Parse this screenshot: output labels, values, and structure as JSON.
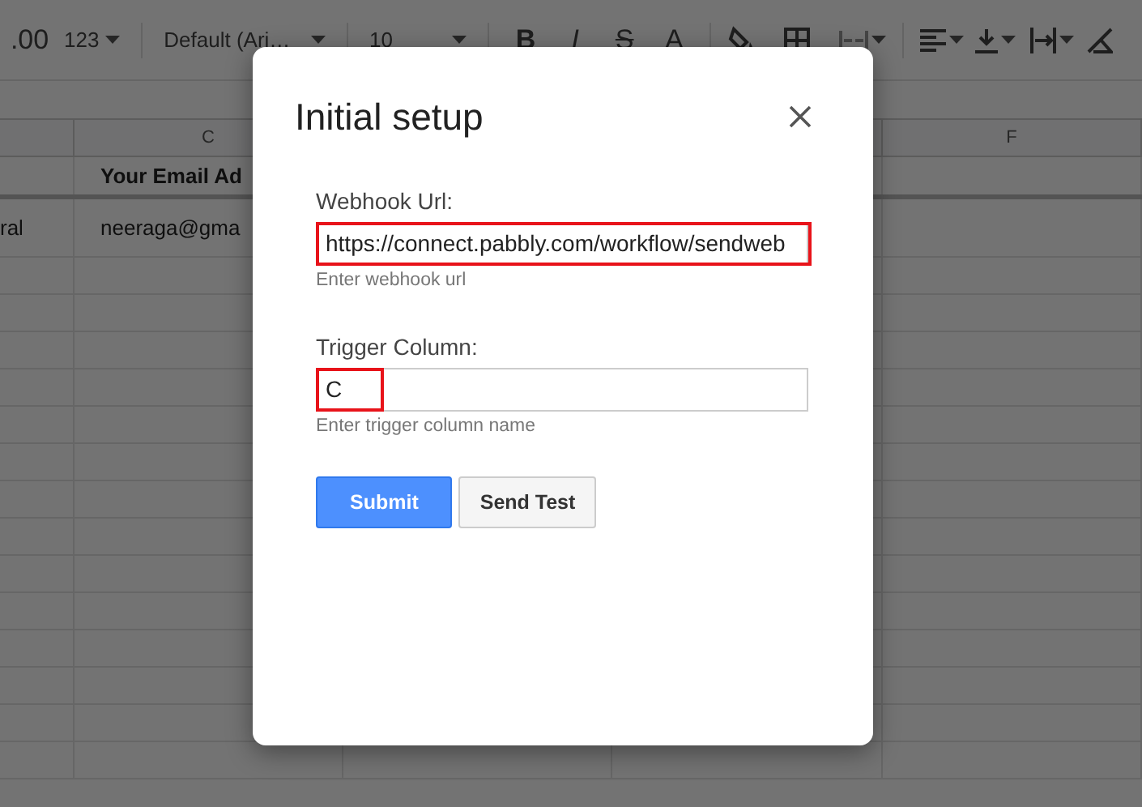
{
  "toolbar": {
    "labels": [
      ".00",
      "123",
      "Default (Ari…",
      "10",
      "B",
      "I",
      "S",
      "A"
    ]
  },
  "sheet": {
    "columns": [
      {},
      {
        "label": "C"
      },
      {},
      {},
      {
        "label": "F"
      }
    ],
    "rows": [
      {
        "cells": [
          null,
          "Your Email Ad"
        ]
      },
      {
        "cells": [
          "ral",
          "neeraga@gma"
        ]
      }
    ]
  },
  "dialog": {
    "title": "Initial setup",
    "fields": [
      {
        "label": "Webhook Url:",
        "value": "https://connect.pabbly.com/workflow/sendweb",
        "help": "Enter webhook url",
        "highlighted": true
      },
      {
        "label": "Trigger Column:",
        "value": "C",
        "help": "Enter trigger column name",
        "highlighted": true
      }
    ],
    "buttons": [
      {
        "label": "Submit",
        "kind": "primary"
      },
      {
        "label": "Send Test",
        "kind": "secondary"
      }
    ]
  }
}
